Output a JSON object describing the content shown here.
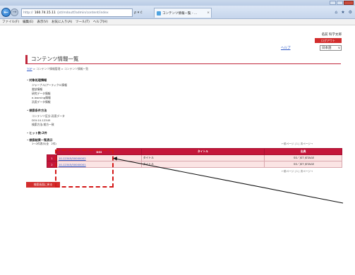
{
  "browser": {
    "url_prefix": "http://",
    "url_host": "160.74.15.11",
    "url_path": "/jst/mdoutf/admin/content/index",
    "address_tools": "ρ ▾ ć",
    "tab_title": "コンテンツ情報一覧 - ...",
    "tab_close": "×",
    "right_icons": [
      "⌂",
      "★",
      "⚙"
    ],
    "back_glyph": "←",
    "forward_glyph": "→"
  },
  "menu": {
    "items": [
      "ファイル(F)",
      "編集(E)",
      "表示(V)",
      "お気に入り(A)",
      "ツール(T)",
      "ヘルプ(H)"
    ]
  },
  "header": {
    "user_name": "名前 科学太郎",
    "logout_label": "ログアウト",
    "help_label": "ヘルプ",
    "language_value": "日本語",
    "language_chevron": "∨"
  },
  "page": {
    "title": "コンテンツ情報一覧",
    "breadcrumb_top": "TOP",
    "breadcrumb_rest": " > コンテンツ情報管理 > コンテンツ情報一覧"
  },
  "target_section": {
    "heading": "・対象処理情報",
    "items": [
      "ジャーナル/アーティクル情報",
      "書誌情報",
      "研究データ情報",
      "e-learning情報",
      "汎用データ情報"
    ]
  },
  "search_section": {
    "heading": "・検索条件方法",
    "items": [
      "コンテンツ区分:汎用データ",
      "DOI:10.12345",
      "検索方法:前方一致"
    ]
  },
  "hits": {
    "label": "・ヒット数:2件"
  },
  "results_section": {
    "heading": "・検索結果一覧表示",
    "count_text": "1～2件表示(全　2件)",
    "pager_text": "←前ページ | 1 | 次ページ→",
    "columns": [
      "DOI",
      "タイトル",
      "出典"
    ],
    "rows": [
      {
        "num": "1",
        "doi": "10.12345/50000002",
        "title": "タイトル",
        "source": "SS／JST JSTAGE"
      },
      {
        "num": "2",
        "doi": "10.12345/50000001",
        "title": "タイトル",
        "source": "SS／JST JSTAGE"
      }
    ]
  },
  "actions": {
    "back_label": "検索画面に戻る"
  },
  "colors": {
    "accent": "#c4163a",
    "annotation": "#d41818",
    "link": "#2a56c6"
  }
}
